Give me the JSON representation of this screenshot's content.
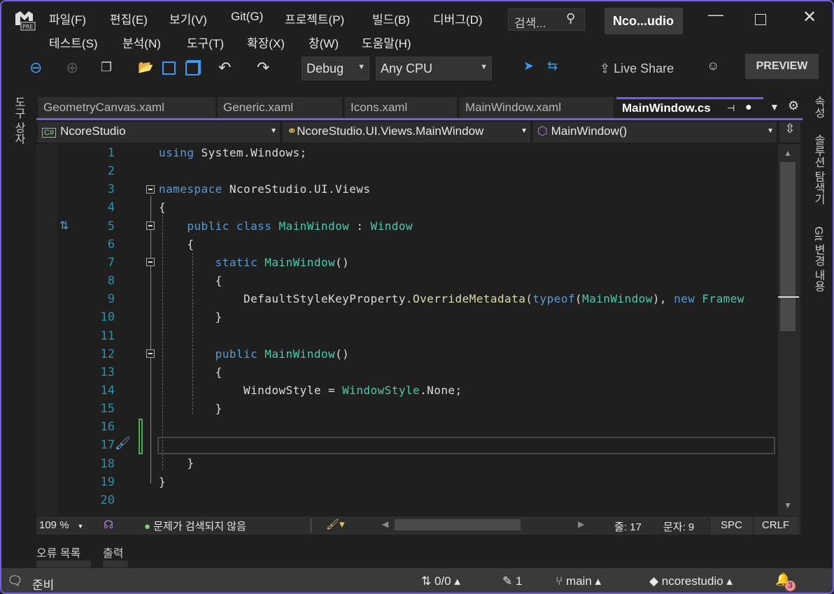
{
  "menu": [
    "파일(F)",
    "편집(E)",
    "보기(V)",
    "Git(G)",
    "프로젝트(P)",
    "빌드(B)",
    "디버그(D)",
    "테스트(S)",
    "분석(N)",
    "도구(T)",
    "확장(X)",
    "창(W)",
    "도움말(H)"
  ],
  "search": {
    "placeholder": "검색..."
  },
  "title": "Nco...udio",
  "toolbar": {
    "config": "Debug",
    "platform": "Any CPU",
    "live_share": "Live Share",
    "preview": "PREVIEW"
  },
  "tabs": [
    "GeometryCanvas.xaml",
    "Generic.xaml",
    "Icons.xaml",
    "MainWindow.xaml",
    "MainWindow.cs"
  ],
  "nav": {
    "project": "NcoreStudio",
    "class": "NcoreStudio.UI.Views.MainWindow",
    "member": "MainWindow()",
    "lang_badge": "C#"
  },
  "left_panel": "도구 상자",
  "right_panels": [
    "속성",
    "솔루션 탐색기",
    "Git 변경 내용"
  ],
  "code": [
    [
      [
        "kw",
        "using"
      ],
      [
        "tx",
        " System.Windows;"
      ]
    ],
    [],
    [
      [
        "kw",
        "namespace"
      ],
      [
        "tx",
        " NcoreStudio.UI.Views"
      ]
    ],
    [
      [
        "tx",
        "{"
      ]
    ],
    [
      [
        "tx",
        "    "
      ],
      [
        "kw",
        "public class"
      ],
      [
        "tx",
        " "
      ],
      [
        "ty",
        "MainWindow"
      ],
      [
        "tx",
        " : "
      ],
      [
        "ty",
        "Window"
      ]
    ],
    [
      [
        "tx",
        "    {"
      ]
    ],
    [
      [
        "tx",
        "        "
      ],
      [
        "kw",
        "static"
      ],
      [
        "tx",
        " "
      ],
      [
        "ty",
        "MainWindow"
      ],
      [
        "tx",
        "()"
      ]
    ],
    [
      [
        "tx",
        "        {"
      ]
    ],
    [
      [
        "tx",
        "            DefaultStyleKeyProperty."
      ],
      [
        "me",
        "OverrideMetadata"
      ],
      [
        "tx",
        "("
      ],
      [
        "kw",
        "typeof"
      ],
      [
        "tx",
        "("
      ],
      [
        "ty",
        "MainWindow"
      ],
      [
        "tx",
        "), "
      ],
      [
        "kw",
        "new"
      ],
      [
        "tx",
        " "
      ],
      [
        "ty",
        "Framew"
      ]
    ],
    [
      [
        "tx",
        "        }"
      ]
    ],
    [],
    [
      [
        "tx",
        "        "
      ],
      [
        "kw",
        "public"
      ],
      [
        "tx",
        " "
      ],
      [
        "ty",
        "MainWindow"
      ],
      [
        "tx",
        "()"
      ]
    ],
    [
      [
        "tx",
        "        {"
      ]
    ],
    [
      [
        "tx",
        "            WindowStyle = "
      ],
      [
        "ty",
        "WindowStyle"
      ],
      [
        "tx",
        ".None;"
      ]
    ],
    [
      [
        "tx",
        "        }"
      ]
    ],
    [],
    [],
    [
      [
        "tx",
        "    }"
      ]
    ],
    [
      [
        "tx",
        "}"
      ]
    ],
    []
  ],
  "editor_status": {
    "zoom": "109 %",
    "issues": "문제가 검색되지 않음",
    "line": "줄: 17",
    "col": "문자: 9",
    "spc": "SPC",
    "crlf": "CRLF"
  },
  "tool_tabs": [
    "오류 목록",
    "출력"
  ],
  "status": {
    "ready": "준비",
    "sync": "0/0",
    "changes": "1",
    "branch": "main",
    "repo": "ncorestudio",
    "notifications": "3"
  },
  "colors": {
    "accent": "#7160e8",
    "keyword": "#569cd6",
    "type": "#4ec9b0",
    "method": "#dcdcaa",
    "line_number": "#2b91af"
  }
}
